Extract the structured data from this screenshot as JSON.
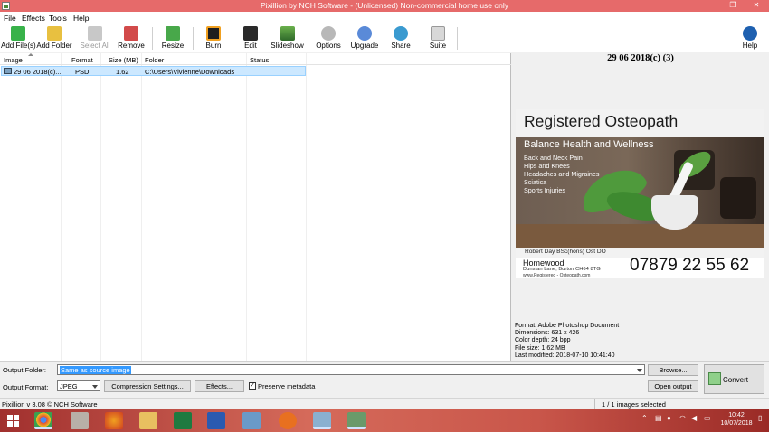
{
  "window": {
    "title": "Pixillion by NCH Software - (Unlicensed) Non-commercial home use only",
    "minimize": "─",
    "maximize": "❐",
    "close": "✕"
  },
  "menu": [
    "File",
    "Effects",
    "Tools",
    "Help"
  ],
  "toolbar": {
    "add_files": "Add File(s)",
    "add_folder": "Add Folder",
    "select_all": "Select All",
    "remove": "Remove",
    "resize": "Resize",
    "burn": "Burn",
    "edit": "Edit",
    "slideshow": "Slideshow",
    "options": "Options",
    "upgrade": "Upgrade",
    "share": "Share",
    "suite": "Suite",
    "help": "Help"
  },
  "file_list": {
    "columns": [
      "Image",
      "Format",
      "Size (MB)",
      "Folder",
      "Status"
    ],
    "rows": [
      {
        "image": "29 06 2018(c)...",
        "format": "PSD",
        "size": "1.62",
        "folder": "C:\\Users\\Vivienne\\Downloads",
        "status": ""
      }
    ]
  },
  "preview": {
    "title": "29 06 2018(c) (3)",
    "image": {
      "heading": "Registered Osteopath",
      "subheading": "Balance Health and Wellness",
      "items": [
        "Back and Neck Pain",
        "Hips and Knees",
        "Headaches and Migraines",
        "Sciatica",
        "Sports Injuries"
      ],
      "person": "Robert Day BSc(hons) Ost DO",
      "place": "Homewood",
      "address": "Dunstan Lane, Burton CH64 8TG",
      "website": "www.Registered - Osteopath.com",
      "phone": "07879 22 55 62"
    },
    "meta": [
      "Format: Adobe Photoshop Document",
      "Dimensions: 631 x 426",
      "Color depth: 24 bpp",
      "File size: 1.62 MB",
      "Last modified: 2018-07-10 10:41:40"
    ]
  },
  "bottom": {
    "output_folder_label": "Output Folder:",
    "output_folder_value": "Same as source image",
    "browse": "Browse...",
    "output_format_label": "Output Format:",
    "output_format_value": "JPEG",
    "compression": "Compression Settings...",
    "effects": "Effects...",
    "preserve_metadata": "Preserve metadata",
    "preserve_checked": "✓",
    "open_output": "Open output",
    "convert": "Convert"
  },
  "status": {
    "version": "Pixillion v 3.08 © NCH Software",
    "selection": "1 / 1 images selected"
  },
  "taskbar": {
    "time": "10:42",
    "date": "10/07/2018"
  }
}
